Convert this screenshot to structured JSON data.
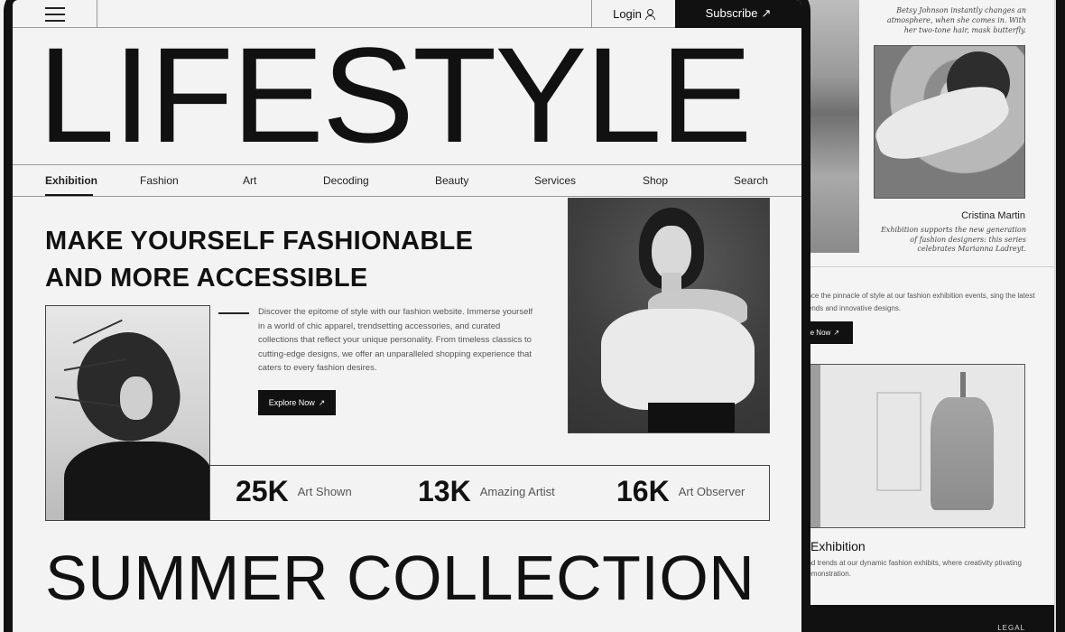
{
  "header": {
    "login_label": "Login",
    "subscribe_label": "Subscribe",
    "arrow": "↗"
  },
  "hero": {
    "title": "LIFESTYLE"
  },
  "nav": {
    "items": [
      {
        "label": "Exhibition"
      },
      {
        "label": "Fashion"
      },
      {
        "label": "Art"
      },
      {
        "label": "Decoding"
      },
      {
        "label": "Beauty"
      },
      {
        "label": "Services"
      },
      {
        "label": "Shop"
      },
      {
        "label": "Search"
      }
    ],
    "active": "Exhibition"
  },
  "main": {
    "headline_line1": "MAKE YOURSELF FASHIONABLE",
    "headline_line2": "AND MORE ACCESSIBLE",
    "body": "Discover the epitome of style with our fashion website. Immerse yourself in a world of chic apparel, trendsetting accessories, and curated collections that reflect your unique personality. From timeless classics to cutting-edge designs, we offer an unparalleled shopping experience that caters to every fashion desires.",
    "explore_label": "Explore Now"
  },
  "stats": [
    {
      "value": "25K",
      "label": "Art Shown"
    },
    {
      "value": "13K",
      "label": "Amazing Artist"
    },
    {
      "value": "16K",
      "label": "Art Observer"
    }
  ],
  "collection_title": "SUMMER COLLECTION",
  "back_page": {
    "caption_top": "Betsy Johnson instantly changes an atmosphere, when she comes in. With her two-tone hair, mask butterfly.",
    "person_name": "Cristina Martin",
    "person_desc": "Exhibition supports the new generation of fashion designers: this series celebrates Marianna Ladreyt.",
    "text2": "ence the pinnacle of style at our fashion exhibition events, sing the latest trends and innovative designs.",
    "button_label": "re Now",
    "exhibition_title": "Exhibition",
    "exhibition_desc": "and trends at our dynamic fashion exhibits, where creativity ptivating demonstration.",
    "footer_label": "LEGAL"
  }
}
